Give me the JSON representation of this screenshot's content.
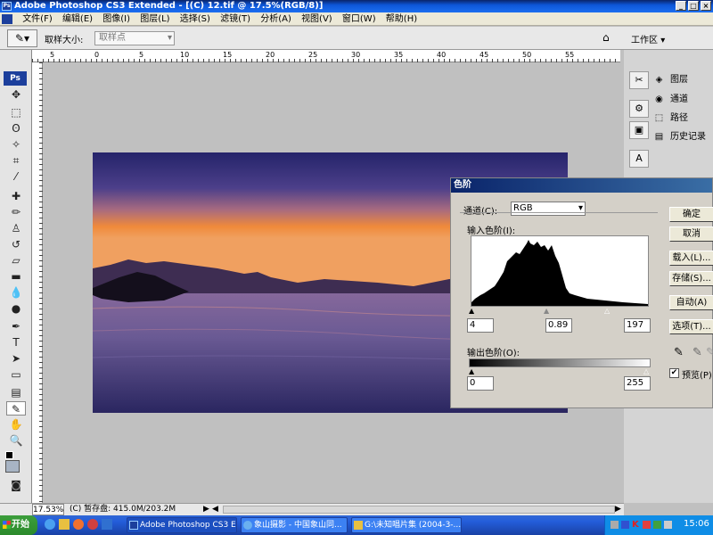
{
  "window": {
    "title": "Adobe Photoshop CS3 Extended - [(C) 12.tif @ 17.5%(RGB/8)]",
    "ps_badge": "Ps"
  },
  "menu": {
    "items": [
      "文件(F)",
      "编辑(E)",
      "图像(I)",
      "图层(L)",
      "选择(S)",
      "滤镜(T)",
      "分析(A)",
      "视图(V)",
      "窗口(W)",
      "帮助(H)"
    ]
  },
  "options": {
    "sample_size_label": "取样大小:",
    "sample_size_value": "取样点",
    "workspace_label": "工作区"
  },
  "ruler": {
    "h_labels": [
      "5",
      "0",
      "5",
      "10",
      "15",
      "20",
      "25",
      "30",
      "35",
      "40",
      "45",
      "50",
      "55"
    ]
  },
  "panels": {
    "items": [
      {
        "label": "图层",
        "icon": "layers-icon"
      },
      {
        "label": "通道",
        "icon": "channels-icon"
      },
      {
        "label": "路径",
        "icon": "paths-icon"
      },
      {
        "label": "历史记录",
        "icon": "history-icon"
      }
    ]
  },
  "dialog": {
    "title": "色阶",
    "channel_label": "通道(C):",
    "channel_value": "RGB",
    "input_levels_label": "输入色阶(I):",
    "input_black": "4",
    "input_gamma": "0.89",
    "input_white": "197",
    "output_levels_label": "输出色阶(O):",
    "output_black": "0",
    "output_white": "255",
    "buttons": {
      "ok": "确定",
      "cancel": "取消",
      "load": "载入(L)...",
      "save": "存储(S)...",
      "auto": "自动(A)",
      "options": "选项(T)..."
    },
    "preview_label": "预览(P)"
  },
  "status": {
    "zoom": "17.53%",
    "scratch": "(C) 暂存盘: 415.0M/203.2M"
  },
  "taskbar": {
    "start": "开始",
    "items": [
      "Adobe Photoshop CS3 E...",
      "象山摄影 - 中国象山同...",
      "G:\\未知唱片集 (2004-3-..."
    ],
    "clock": "15:06"
  }
}
